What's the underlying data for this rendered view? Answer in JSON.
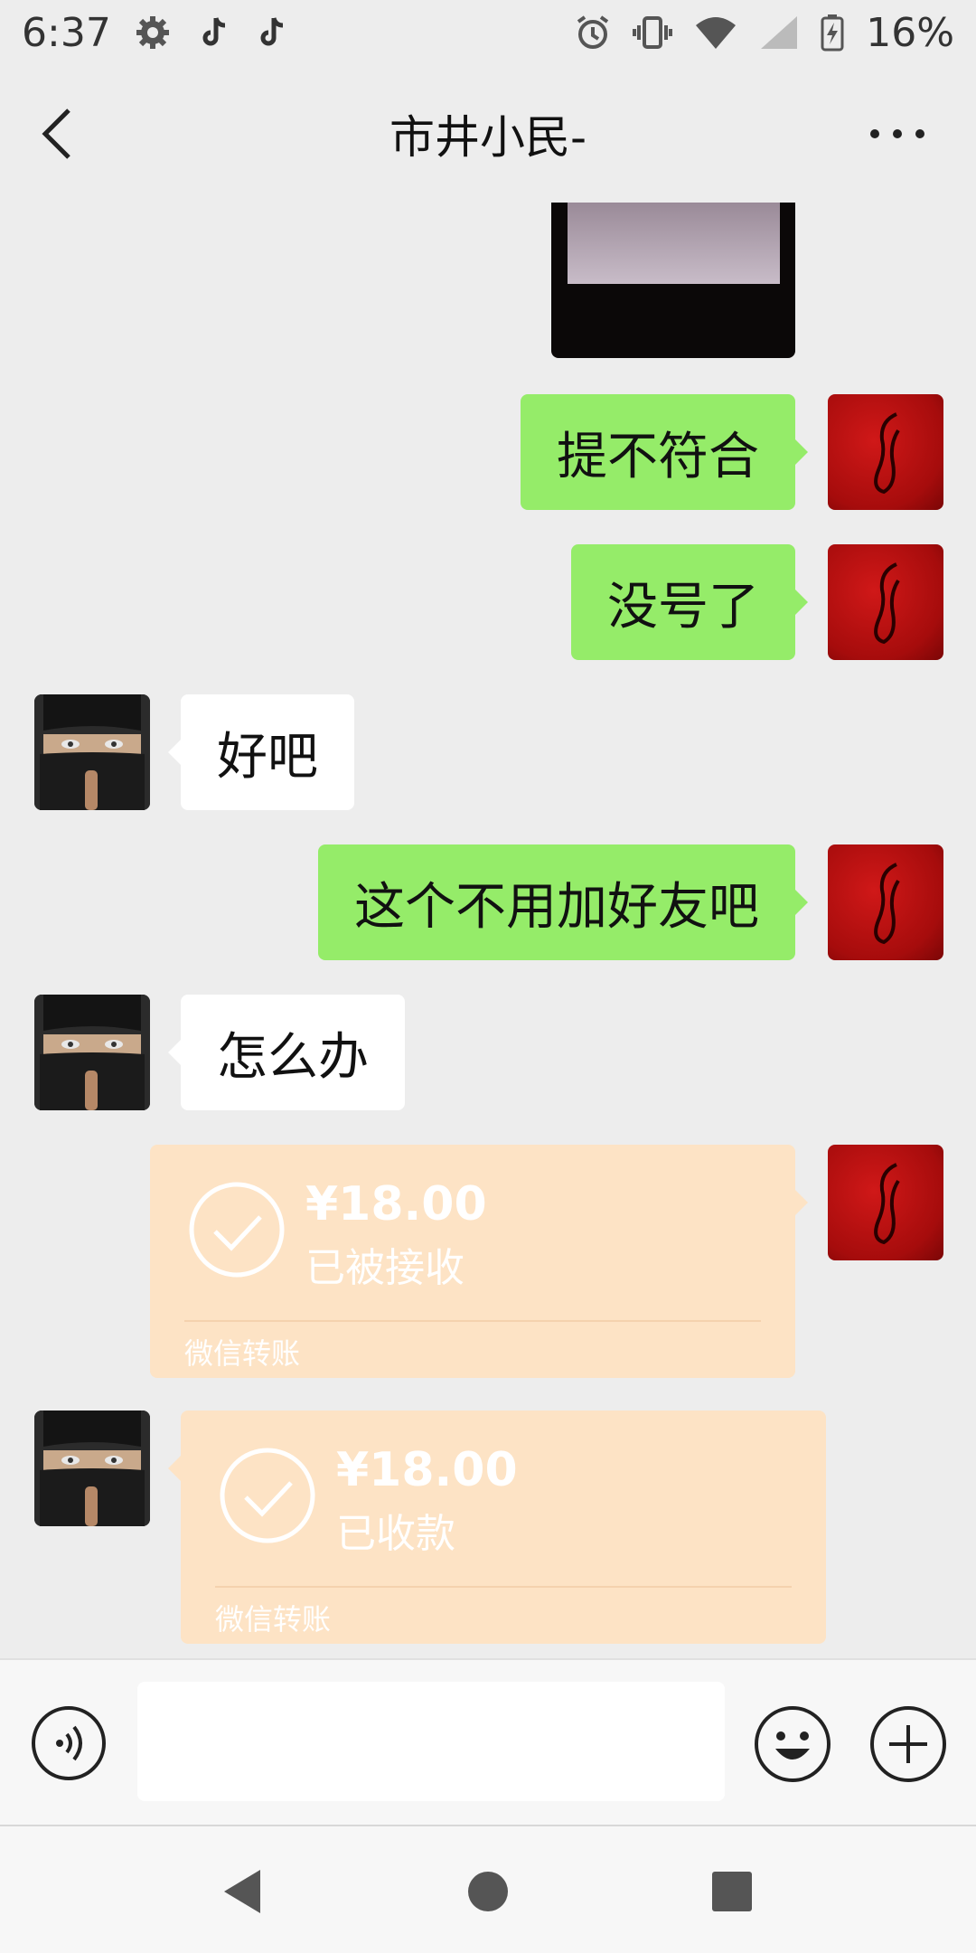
{
  "status_bar": {
    "time": "6:37",
    "battery": "16%",
    "icons": [
      "gear-icon",
      "tiktok-icon",
      "tiktok-icon",
      "alarm-icon",
      "vibrate-icon",
      "wifi-icon",
      "signal-icon",
      "battery-charging-icon"
    ]
  },
  "header": {
    "title": "市井小民-",
    "back_icon": "chevron-left-icon",
    "more_icon": "more-dots-icon"
  },
  "messages": [
    {
      "type": "image",
      "from": "me"
    },
    {
      "type": "text",
      "from": "me",
      "text": "提不符合"
    },
    {
      "type": "text",
      "from": "me",
      "text": "没号了"
    },
    {
      "type": "text",
      "from": "them",
      "text": "好吧"
    },
    {
      "type": "text",
      "from": "me",
      "text": "这个不用加好友吧"
    },
    {
      "type": "text",
      "from": "them",
      "text": "怎么办"
    },
    {
      "type": "transfer",
      "from": "me",
      "amount": "¥18.00",
      "status": "已被接收",
      "label": "微信转账"
    },
    {
      "type": "transfer",
      "from": "them",
      "amount": "¥18.00",
      "status": "已收款",
      "label": "微信转账"
    }
  ],
  "input_bar": {
    "voice_icon": "voice-icon",
    "input_value": "",
    "emoji_icon": "emoji-icon",
    "plus_icon": "plus-circle-icon"
  },
  "system_nav": [
    "back-triangle-icon",
    "home-circle-icon",
    "recents-square-icon"
  ],
  "colors": {
    "background": "#ededed",
    "my_bubble": "#95ec69",
    "their_bubble": "#ffffff",
    "transfer_card": "#fde3c5"
  }
}
